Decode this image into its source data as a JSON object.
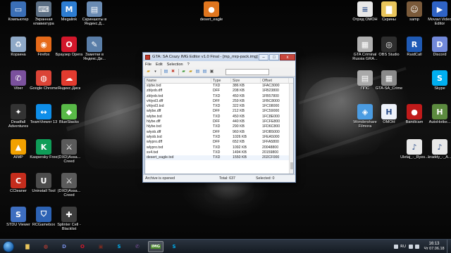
{
  "desktop": {
    "icons": [
      {
        "label": "Компьютер",
        "icon": "computer-icon",
        "color": "#3b6fb6",
        "glyph": "▭"
      },
      {
        "label": "Экранная клавиатура",
        "icon": "keyboard-icon",
        "color": "#5c6f84",
        "glyph": "⌨"
      },
      {
        "label": "Megalink",
        "icon": "megalink-icon",
        "color": "#2d7dd2",
        "glyph": "M"
      },
      {
        "label": "Скриншоты в Яндекс.Д...",
        "icon": "folder-shortcut-icon",
        "color": "#6a8bb3",
        "glyph": "▤"
      },
      {
        "label": "desert_eagle",
        "icon": "media-file-icon",
        "color": "#e0761e",
        "glyph": "●"
      },
      {
        "label": "Отряд ОМОН",
        "icon": "document-icon",
        "color": "#e7e7e7",
        "glyph": "≡"
      },
      {
        "label": "Скрины",
        "icon": "folder-icon",
        "color": "#e9c55b",
        "glyph": "▇"
      },
      {
        "label": "samp",
        "icon": "samp-icon",
        "color": "#7a5a3a",
        "glyph": "☺"
      },
      {
        "label": "Movavi Video Editor",
        "icon": "movavi-icon",
        "color": "#2f63c5",
        "glyph": "▶"
      },
      {
        "label": "Корзина",
        "icon": "recycle-bin-icon",
        "color": "#8fa9c7",
        "glyph": "♻"
      },
      {
        "label": "Firefox",
        "icon": "firefox-icon",
        "color": "#e66a1a",
        "glyph": "◉"
      },
      {
        "label": "Браузер Opera",
        "icon": "opera-icon",
        "color": "#d3172b",
        "glyph": "O"
      },
      {
        "label": "Заметки в Яндекс.Ди...",
        "icon": "notes-icon",
        "color": "#5a7ea8",
        "glyph": "✎"
      },
      {
        "label": "GTA Criminal Russia GRA...",
        "icon": "gta-criminal-icon",
        "color": "#b0b0b0",
        "glyph": "▦"
      },
      {
        "label": "OBS Studio",
        "icon": "obs-icon",
        "color": "#2d2d2d",
        "glyph": "◎"
      },
      {
        "label": "RaidCall",
        "icon": "raidcall-icon",
        "color": "#1f5ab5",
        "glyph": "R"
      },
      {
        "label": "Discord",
        "icon": "discord-icon",
        "color": "#7289da",
        "glyph": "D"
      },
      {
        "label": "Viber",
        "icon": "viber-icon",
        "color": "#7b519d",
        "glyph": "✆"
      },
      {
        "label": "Google Chrome",
        "icon": "chrome-icon",
        "color": "#db4437",
        "glyph": "◍"
      },
      {
        "label": "Яндекс.Диск",
        "icon": "yandex-disk-icon",
        "color": "#e23b2f",
        "glyph": "☁"
      },
      {
        "label": "ППС",
        "icon": "pps-folder-icon",
        "color": "#a9a9a9",
        "glyph": "▤"
      },
      {
        "label": "GTA-SA_Crime",
        "icon": "gta-sa-icon",
        "color": "#8a8a8a",
        "glyph": "▦"
      },
      {
        "label": "Skype",
        "icon": "skype-icon",
        "color": "#00aff0",
        "glyph": "S"
      },
      {
        "label": "Deadfall Adventures",
        "icon": "deadfall-icon",
        "color": "#333",
        "glyph": "✦"
      },
      {
        "label": "TeamViewer 13",
        "icon": "teamviewer-icon",
        "color": "#0e8ee9",
        "glyph": "↔"
      },
      {
        "label": "BlueStacks",
        "icon": "bluestacks-icon",
        "color": "#58b947",
        "glyph": "◆"
      },
      {
        "label": "Wondershare Filmora",
        "icon": "filmora-icon",
        "color": "#4b9ce2",
        "glyph": "◈"
      },
      {
        "label": "ОМОН",
        "icon": "omon-document-icon",
        "color": "#eef2fa",
        "glyph": "H"
      },
      {
        "label": "Bandicam",
        "icon": "bandicam-icon",
        "color": "#c01a1a",
        "glyph": "●"
      },
      {
        "label": "AutoHotke...",
        "icon": "autohotkey-icon",
        "color": "#5c8b3f",
        "glyph": "H"
      },
      {
        "label": "AIMP",
        "icon": "aimp-icon",
        "color": "#f2a100",
        "glyph": "▲"
      },
      {
        "label": "Kaspersky Free",
        "icon": "kaspersky-icon",
        "color": "#0f9d58",
        "glyph": "K"
      },
      {
        "label": "(DXD)Assa... Creed",
        "icon": "assassins-creed-icon",
        "color": "#5b5b5b",
        "glyph": "⚔"
      },
      {
        "label": "Uletaj_-_Ryes...",
        "icon": "mp3-file-icon",
        "color": "#e8e8e8",
        "glyph": "♪"
      },
      {
        "label": "kraddy_-_A...",
        "icon": "mp3-file-icon-2",
        "color": "#e8e8e8",
        "glyph": "♪"
      },
      {
        "label": "CCleaner",
        "icon": "ccleaner-icon",
        "color": "#c52d1d",
        "glyph": "C"
      },
      {
        "label": "Uninstall Tool",
        "icon": "uninstall-tool-icon",
        "color": "#4c4c4c",
        "glyph": "U"
      },
      {
        "label": "(DXD)Assa... Creed",
        "icon": "assassins-creed-icon-2",
        "color": "#5b5b5b",
        "glyph": "⚔"
      },
      {
        "label": "STDU Viewer",
        "icon": "stdu-viewer-icon",
        "color": "#3e6ec0",
        "glyph": "S"
      },
      {
        "label": "RCGamebox",
        "icon": "rcgamebox-icon",
        "color": "#2c62b4",
        "glyph": "⛉"
      },
      {
        "label": "Splinter Cell - Blacklist",
        "icon": "splinter-cell-icon",
        "color": "#3d3d3d",
        "glyph": "✚"
      }
    ]
  },
  "window": {
    "title": "GTA: SA Crazy IMG Editor v1.0 Final - [mp_mrp-pack.img]",
    "buttons": {
      "minimize": "–",
      "maximize": "□",
      "close": "x"
    },
    "menu": [
      "File",
      "Edit",
      "Selection",
      "?"
    ],
    "toolbar_icons": [
      "open-folder-icon",
      "add-file-icon",
      "replace-file-icon",
      "extract-icon",
      "delete-icon",
      "rebuild-icon",
      "find-icon"
    ],
    "search": {
      "value": ""
    },
    "columns": [
      "Name",
      "Type",
      "Size",
      "Offset"
    ],
    "rows": [
      [
        "slybe.txd",
        "TXD",
        "386 KB",
        "1FAC3000"
      ],
      [
        "zblyob.dff",
        "DFF",
        "208 KB",
        "1FB23800"
      ],
      [
        "zblyob.txd",
        "TXD",
        "450 KB",
        "1FB57800"
      ],
      [
        "vhlyol3.dff",
        "DFF",
        "259 KB",
        "1FBC8000"
      ],
      [
        "vhlyol3.txd",
        "TXD",
        "322 KB",
        "1FC08000"
      ],
      [
        "wlybe.dff",
        "DFF",
        "212 KB",
        "1FC59000"
      ],
      [
        "wlybe.txd",
        "TXD",
        "450 KB",
        "1FC8E000"
      ],
      [
        "hlybe.dff",
        "DFF",
        "440 KB",
        "1FCFE800"
      ],
      [
        "hlybe.txd",
        "TXD",
        "290 KB",
        "1FD6C800"
      ],
      [
        "wlyob.dff",
        "DFF",
        "960 KB",
        "1FDB5000"
      ],
      [
        "wlyob.txd",
        "TXD",
        "1026 KB",
        "1FEA5000"
      ],
      [
        "wlypro.dff",
        "DFF",
        "652 KB",
        "1FFA5800"
      ],
      [
        "wlypro.txd",
        "TXD",
        "1092 KB",
        "20048800"
      ],
      [
        "sv4.txd",
        "TXD",
        "1494 KB",
        "20159800"
      ],
      [
        "desert_eagle.txd",
        "TXD",
        "1550 KB",
        "202CF000"
      ]
    ],
    "status": {
      "state": "Archive is opened",
      "total": "Total: 637",
      "selected": "Selected: 0"
    }
  },
  "taskbar": {
    "apps": [
      {
        "name": "taskbar-explorer",
        "icon": "folder-icon",
        "glyph": "▇",
        "color": "#e9c55b"
      },
      {
        "name": "taskbar-chrome",
        "icon": "chrome-icon",
        "glyph": "◍",
        "color": "#db4437"
      },
      {
        "name": "taskbar-discord",
        "icon": "discord-icon",
        "glyph": "D",
        "color": "#7289da"
      },
      {
        "name": "taskbar-opera",
        "icon": "opera-icon",
        "glyph": "O",
        "color": "#d3172b"
      },
      {
        "name": "taskbar-app-red",
        "icon": "app-red-icon",
        "glyph": "▣",
        "color": "#7a2b20"
      },
      {
        "name": "taskbar-skype",
        "icon": "skype-icon",
        "glyph": "S",
        "color": "#00aff0"
      },
      {
        "name": "taskbar-viber",
        "icon": "viber-icon",
        "glyph": "✆",
        "color": "#7b519d"
      },
      {
        "name": "taskbar-img-editor",
        "icon": "img-editor-icon",
        "glyph": "IMG",
        "color": "#4c8c2b"
      },
      {
        "name": "taskbar-skype-2",
        "icon": "skype-icon",
        "glyph": "S",
        "color": "#00aff0"
      }
    ],
    "tray": {
      "language": "RU",
      "time": "16:13",
      "date": "Чт 07.06.18"
    }
  }
}
